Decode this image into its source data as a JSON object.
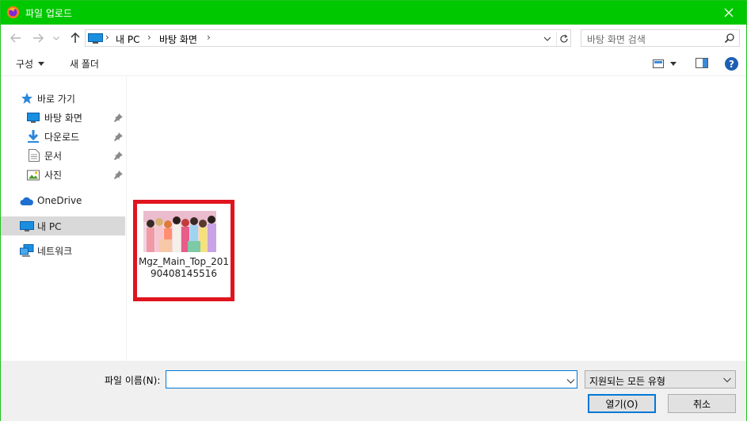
{
  "window": {
    "title": "파일 업로드",
    "accent_color": "#00c800"
  },
  "address": {
    "crumbs": [
      "내 PC",
      "바탕 화면"
    ],
    "search_placeholder": "바탕 화면 검색"
  },
  "toolbar": {
    "organize_label": "구성",
    "new_folder_label": "새 폴더",
    "help_label": "?"
  },
  "sidebar": {
    "quick_access_label": "바로 가기",
    "items": [
      {
        "label": "바탕 화면",
        "icon": "desktop-icon",
        "pinned": true
      },
      {
        "label": "다운로드",
        "icon": "download-icon",
        "pinned": true
      },
      {
        "label": "문서",
        "icon": "document-icon",
        "pinned": true
      },
      {
        "label": "사진",
        "icon": "pictures-icon",
        "pinned": true
      }
    ],
    "onedrive_label": "OneDrive",
    "this_pc_label": "내 PC",
    "network_label": "네트워크"
  },
  "files": [
    {
      "name": "Mgz_Main_Top_20190408145516",
      "type": "image",
      "highlighted": true,
      "highlight_color": "#e0141e"
    }
  ],
  "bottom": {
    "filename_label": "파일 이름(N):",
    "filename_value": "",
    "filetype_value": "지원되는 모든 유형",
    "open_label": "열기(O)",
    "cancel_label": "취소"
  }
}
